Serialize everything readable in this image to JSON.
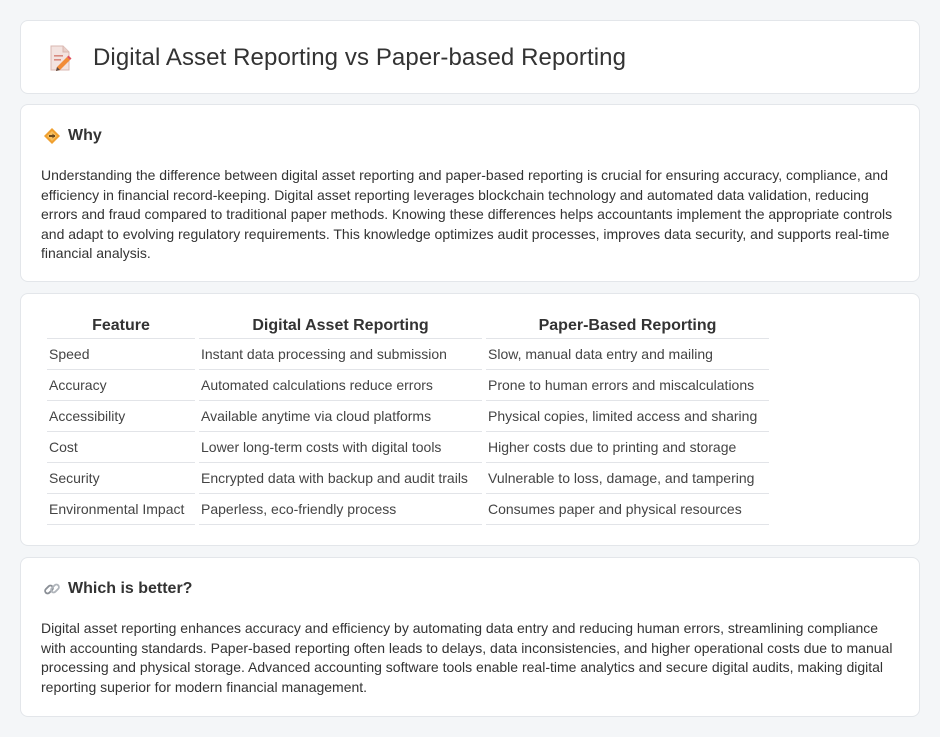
{
  "header": {
    "title": "Digital Asset Reporting vs Paper-based Reporting",
    "icon": "document-pencil-icon"
  },
  "why": {
    "title": "Why",
    "icon": "diamond-warning-icon",
    "text": "Understanding the difference between digital asset reporting and paper-based reporting is crucial for ensuring accuracy, compliance, and efficiency in financial record-keeping. Digital asset reporting leverages blockchain technology and automated data validation, reducing errors and fraud compared to traditional paper methods. Knowing these differences helps accountants implement the appropriate controls and adapt to evolving regulatory requirements. This knowledge optimizes audit processes, improves data security, and supports real-time financial analysis."
  },
  "table": {
    "headers": [
      "Feature",
      "Digital Asset Reporting",
      "Paper-Based Reporting"
    ],
    "rows": [
      [
        "Speed",
        "Instant data processing and submission",
        "Slow, manual data entry and mailing"
      ],
      [
        "Accuracy",
        "Automated calculations reduce errors",
        "Prone to human errors and miscalculations"
      ],
      [
        "Accessibility",
        "Available anytime via cloud platforms",
        "Physical copies, limited access and sharing"
      ],
      [
        "Cost",
        "Lower long-term costs with digital tools",
        "Higher costs due to printing and storage"
      ],
      [
        "Security",
        "Encrypted data with backup and audit trails",
        "Vulnerable to loss, damage, and tampering"
      ],
      [
        "Environmental Impact",
        "Paperless, eco-friendly process",
        "Consumes paper and physical resources"
      ]
    ]
  },
  "better": {
    "title": "Which is better?",
    "icon": "link-icon",
    "text": "Digital asset reporting enhances accuracy and efficiency by automating data entry and reducing human errors, streamlining compliance with accounting standards. Paper-based reporting often leads to delays, data inconsistencies, and higher operational costs due to manual processing and physical storage. Advanced accounting software tools enable real-time analytics and secure digital audits, making digital reporting superior for modern financial management."
  },
  "colors": {
    "background": "#f4f6f8",
    "card": "#ffffff",
    "accent_orange": "#f0a030",
    "icon_pink": "#e06070"
  }
}
